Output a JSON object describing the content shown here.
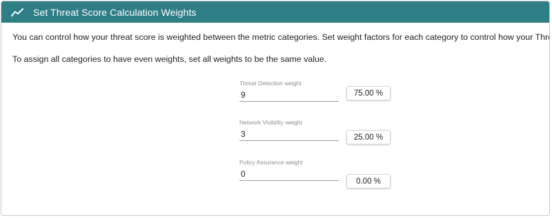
{
  "header": {
    "icon": "trend-line-icon",
    "title": "Set Threat Score Calculation Weights",
    "bg_color": "#2e7e86"
  },
  "intro": {
    "line1": "You can control how your threat score is weighted between the metric categories. Set weight factors for each category to control how your Threat Score is calculated",
    "line2": "To assign all categories to have even weights, set all weights to be the same value."
  },
  "weights": [
    {
      "label": "Threat Detection weight",
      "value": "9",
      "percent": "75.00 %"
    },
    {
      "label": "Network Visibility weight",
      "value": "3",
      "percent": "25.00 %"
    },
    {
      "label": "Policy Assurance weight",
      "value": "0",
      "percent": "0.00 %"
    }
  ]
}
